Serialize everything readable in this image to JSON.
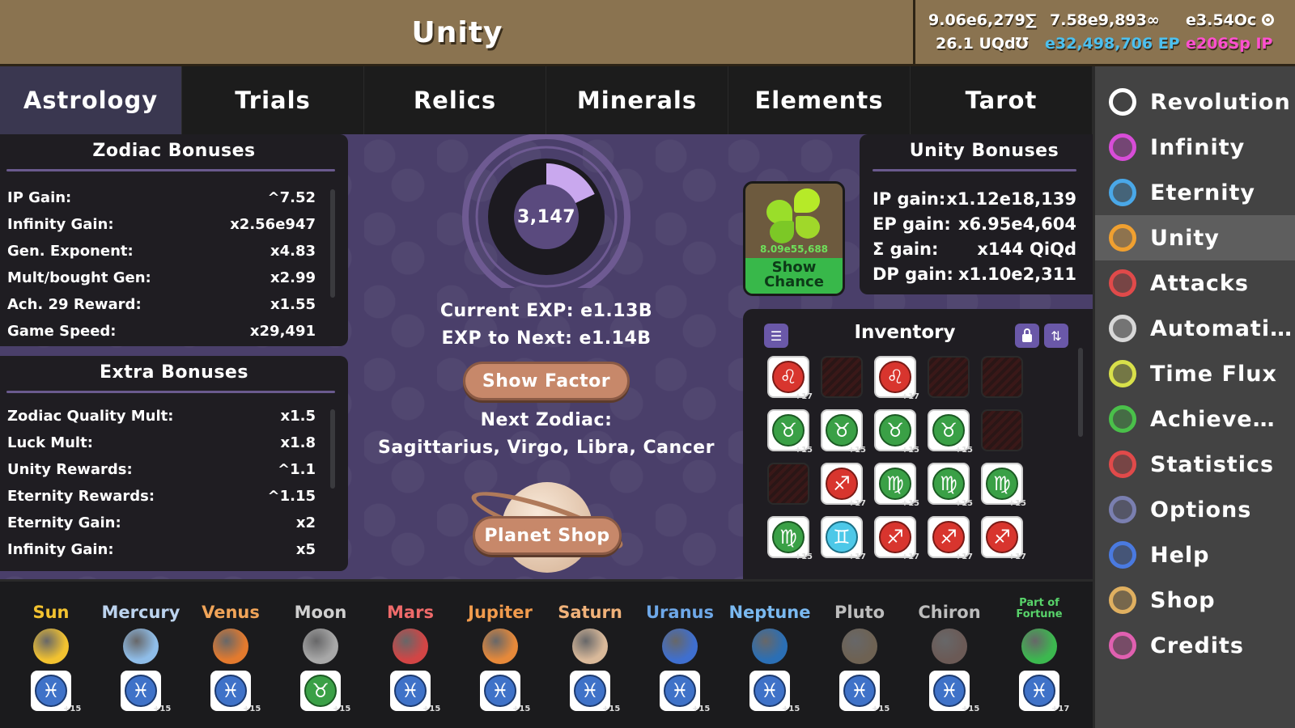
{
  "header": {
    "title": "Unity",
    "resources": [
      {
        "value": "9.06e6,279∑",
        "color": "#ffffff"
      },
      {
        "value": "7.58e9,893∞",
        "color": "#ffffff"
      },
      {
        "value": "e3.54Oc",
        "color": "#ffffff",
        "icon": "revolution-icon"
      },
      {
        "value": "26.1 UQd℧",
        "color": "#ffffff"
      },
      {
        "value": "e32,498,706 EP",
        "color": "#4cc0ef"
      },
      {
        "value": "e206Sp IP",
        "color": "#ff4fd0"
      }
    ]
  },
  "tabs": [
    {
      "label": "Astrology",
      "active": true
    },
    {
      "label": "Trials"
    },
    {
      "label": "Relics"
    },
    {
      "label": "Minerals"
    },
    {
      "label": "Elements"
    },
    {
      "label": "Tarot"
    }
  ],
  "zodiac_bonuses": {
    "title": "Zodiac Bonuses",
    "rows": [
      {
        "label": "IP Gain:",
        "value": "^7.52"
      },
      {
        "label": "Infinity Gain:",
        "value": "x2.56e947"
      },
      {
        "label": "Gen. Exponent:",
        "value": "x4.83"
      },
      {
        "label": "Mult/bought Gen:",
        "value": "x2.99"
      },
      {
        "label": "Ach. 29 Reward:",
        "value": "x1.55"
      },
      {
        "label": "Game Speed:",
        "value": "x29,491"
      }
    ]
  },
  "extra_bonuses": {
    "title": "Extra Bonuses",
    "rows": [
      {
        "label": "Zodiac Quality Mult:",
        "value": "x1.5"
      },
      {
        "label": "Luck Mult:",
        "value": "x1.8"
      },
      {
        "label": "Unity Rewards:",
        "value": "^1.1"
      },
      {
        "label": "Eternity Rewards:",
        "value": "^1.15"
      },
      {
        "label": "Eternity Gain:",
        "value": "x2"
      },
      {
        "label": "Infinity Gain:",
        "value": "x5"
      }
    ]
  },
  "wheel": {
    "level": "3,147",
    "progress": 0.18,
    "current_exp": "Current EXP: e1.13B",
    "exp_next": "EXP to Next: e1.14B",
    "show_factor": "Show Factor",
    "next_zodiac_label": "Next Zodiac:",
    "next_zodiac_list": "Sagittarius, Virgo, Libra, Cancer",
    "planet_shop": "Planet Shop"
  },
  "clover": {
    "value": "8.09e55,688",
    "button": "Show Chance"
  },
  "unity_bonuses": {
    "title": "Unity Bonuses",
    "rows": [
      {
        "label": "IP gain:",
        "value": "x1.12e18,139"
      },
      {
        "label": "EP gain:",
        "value": "x6.95e4,604"
      },
      {
        "label": "Σ gain:",
        "value": "x144 QiQd"
      },
      {
        "label": "DP gain:",
        "value": "x1.10e2,311"
      }
    ]
  },
  "inventory": {
    "title": "Inventory",
    "slots": [
      {
        "sign": "♌",
        "color": "red",
        "badge": "+17"
      },
      {
        "empty": true
      },
      {
        "sign": "♌",
        "color": "red",
        "badge": "+17"
      },
      {
        "empty": true
      },
      {
        "empty": true
      },
      {
        "sign": "♉",
        "color": "green",
        "badge": "+15"
      },
      {
        "sign": "♉",
        "color": "green",
        "badge": "+15"
      },
      {
        "sign": "♉",
        "color": "green",
        "badge": "+15"
      },
      {
        "sign": "♉",
        "color": "green",
        "badge": "+15"
      },
      {
        "empty": true
      },
      {
        "empty": true
      },
      {
        "sign": "♐",
        "color": "red",
        "badge": "+17"
      },
      {
        "sign": "♍",
        "color": "green",
        "badge": "+15"
      },
      {
        "sign": "♍",
        "color": "green",
        "badge": "+15"
      },
      {
        "sign": "♍",
        "color": "green",
        "badge": "+15"
      },
      {
        "sign": "♍",
        "color": "green",
        "badge": "+15"
      },
      {
        "sign": "♊",
        "color": "cyan",
        "badge": "+17"
      },
      {
        "sign": "♐",
        "color": "red",
        "badge": "+17"
      },
      {
        "sign": "♐",
        "color": "red",
        "badge": "+17"
      },
      {
        "sign": "♐",
        "color": "red",
        "badge": "+17"
      }
    ]
  },
  "planets": [
    {
      "name": "Sun",
      "name_color": "#f2c230",
      "ball": "#f2c230",
      "sign": "♓",
      "slot": "blue",
      "badge": "+15"
    },
    {
      "name": "Mercury",
      "name_color": "#bcd3ee",
      "ball": "#8fbde8",
      "sign": "♓",
      "slot": "blue",
      "badge": "+15"
    },
    {
      "name": "Venus",
      "name_color": "#f0a458",
      "ball": "#e37a2e",
      "sign": "♓",
      "slot": "blue",
      "badge": "+15"
    },
    {
      "name": "Moon",
      "name_color": "#cfcfcf",
      "ball": "#a8a8a8",
      "sign": "♉",
      "slot": "green",
      "badge": "+15"
    },
    {
      "name": "Mars",
      "name_color": "#ee6a6a",
      "ball": "#d24545",
      "sign": "♓",
      "slot": "blue",
      "badge": "+15"
    },
    {
      "name": "Jupiter",
      "name_color": "#f19b4d",
      "ball": "#e6893a",
      "sign": "♓",
      "slot": "blue",
      "badge": "+15"
    },
    {
      "name": "Saturn",
      "name_color": "#f0b27a",
      "ball": "#d9b99a",
      "sign": "♓",
      "slot": "blue",
      "badge": "+15"
    },
    {
      "name": "Uranus",
      "name_color": "#6ea8e8",
      "ball": "#3f6fcf",
      "sign": "♓",
      "slot": "blue",
      "badge": "+15"
    },
    {
      "name": "Neptune",
      "name_color": "#7ab9f0",
      "ball": "#2b6fb5",
      "sign": "♓",
      "slot": "blue",
      "badge": "+15"
    },
    {
      "name": "Pluto",
      "name_color": "#bdbdbd",
      "ball": "#6e6253",
      "sign": "♓",
      "slot": "blue",
      "badge": "+15"
    },
    {
      "name": "Chiron",
      "name_color": "#bdbdbd",
      "ball": "#6b5a56",
      "sign": "♓",
      "slot": "blue",
      "badge": "+15"
    },
    {
      "name": "Part of Fortune",
      "name_color": "#58d36a",
      "ball": "#3cb84f",
      "sign": "♓",
      "slot": "blue",
      "badge": "+17"
    }
  ],
  "sidebar": [
    {
      "label": "Revolution",
      "icon": "revolution-icon",
      "color": "#ffffff"
    },
    {
      "label": "Infinity",
      "icon": "infinity-icon",
      "color": "#d84dd8"
    },
    {
      "label": "Eternity",
      "icon": "eternity-icon",
      "color": "#4aa8e8"
    },
    {
      "label": "Unity",
      "icon": "unity-icon",
      "color": "#f0a030",
      "active": true
    },
    {
      "label": "Attacks",
      "icon": "attacks-icon",
      "color": "#e04a4a"
    },
    {
      "label": "Automation",
      "icon": "automation-icon",
      "color": "#d8d8d8"
    },
    {
      "label": "Time Flux",
      "icon": "time-flux-icon",
      "color": "#d8e04a"
    },
    {
      "label": "Achieveme...",
      "icon": "achievements-icon",
      "color": "#4ac04a"
    },
    {
      "label": "Statistics",
      "icon": "statistics-icon",
      "color": "#e04a4a"
    },
    {
      "label": "Options",
      "icon": "options-icon",
      "color": "#7a7fb0"
    },
    {
      "label": "Help",
      "icon": "help-icon",
      "color": "#4a7ae0"
    },
    {
      "label": "Shop",
      "icon": "shop-icon",
      "color": "#e0b060"
    },
    {
      "label": "Credits",
      "icon": "credits-icon",
      "color": "#e060b0"
    }
  ]
}
